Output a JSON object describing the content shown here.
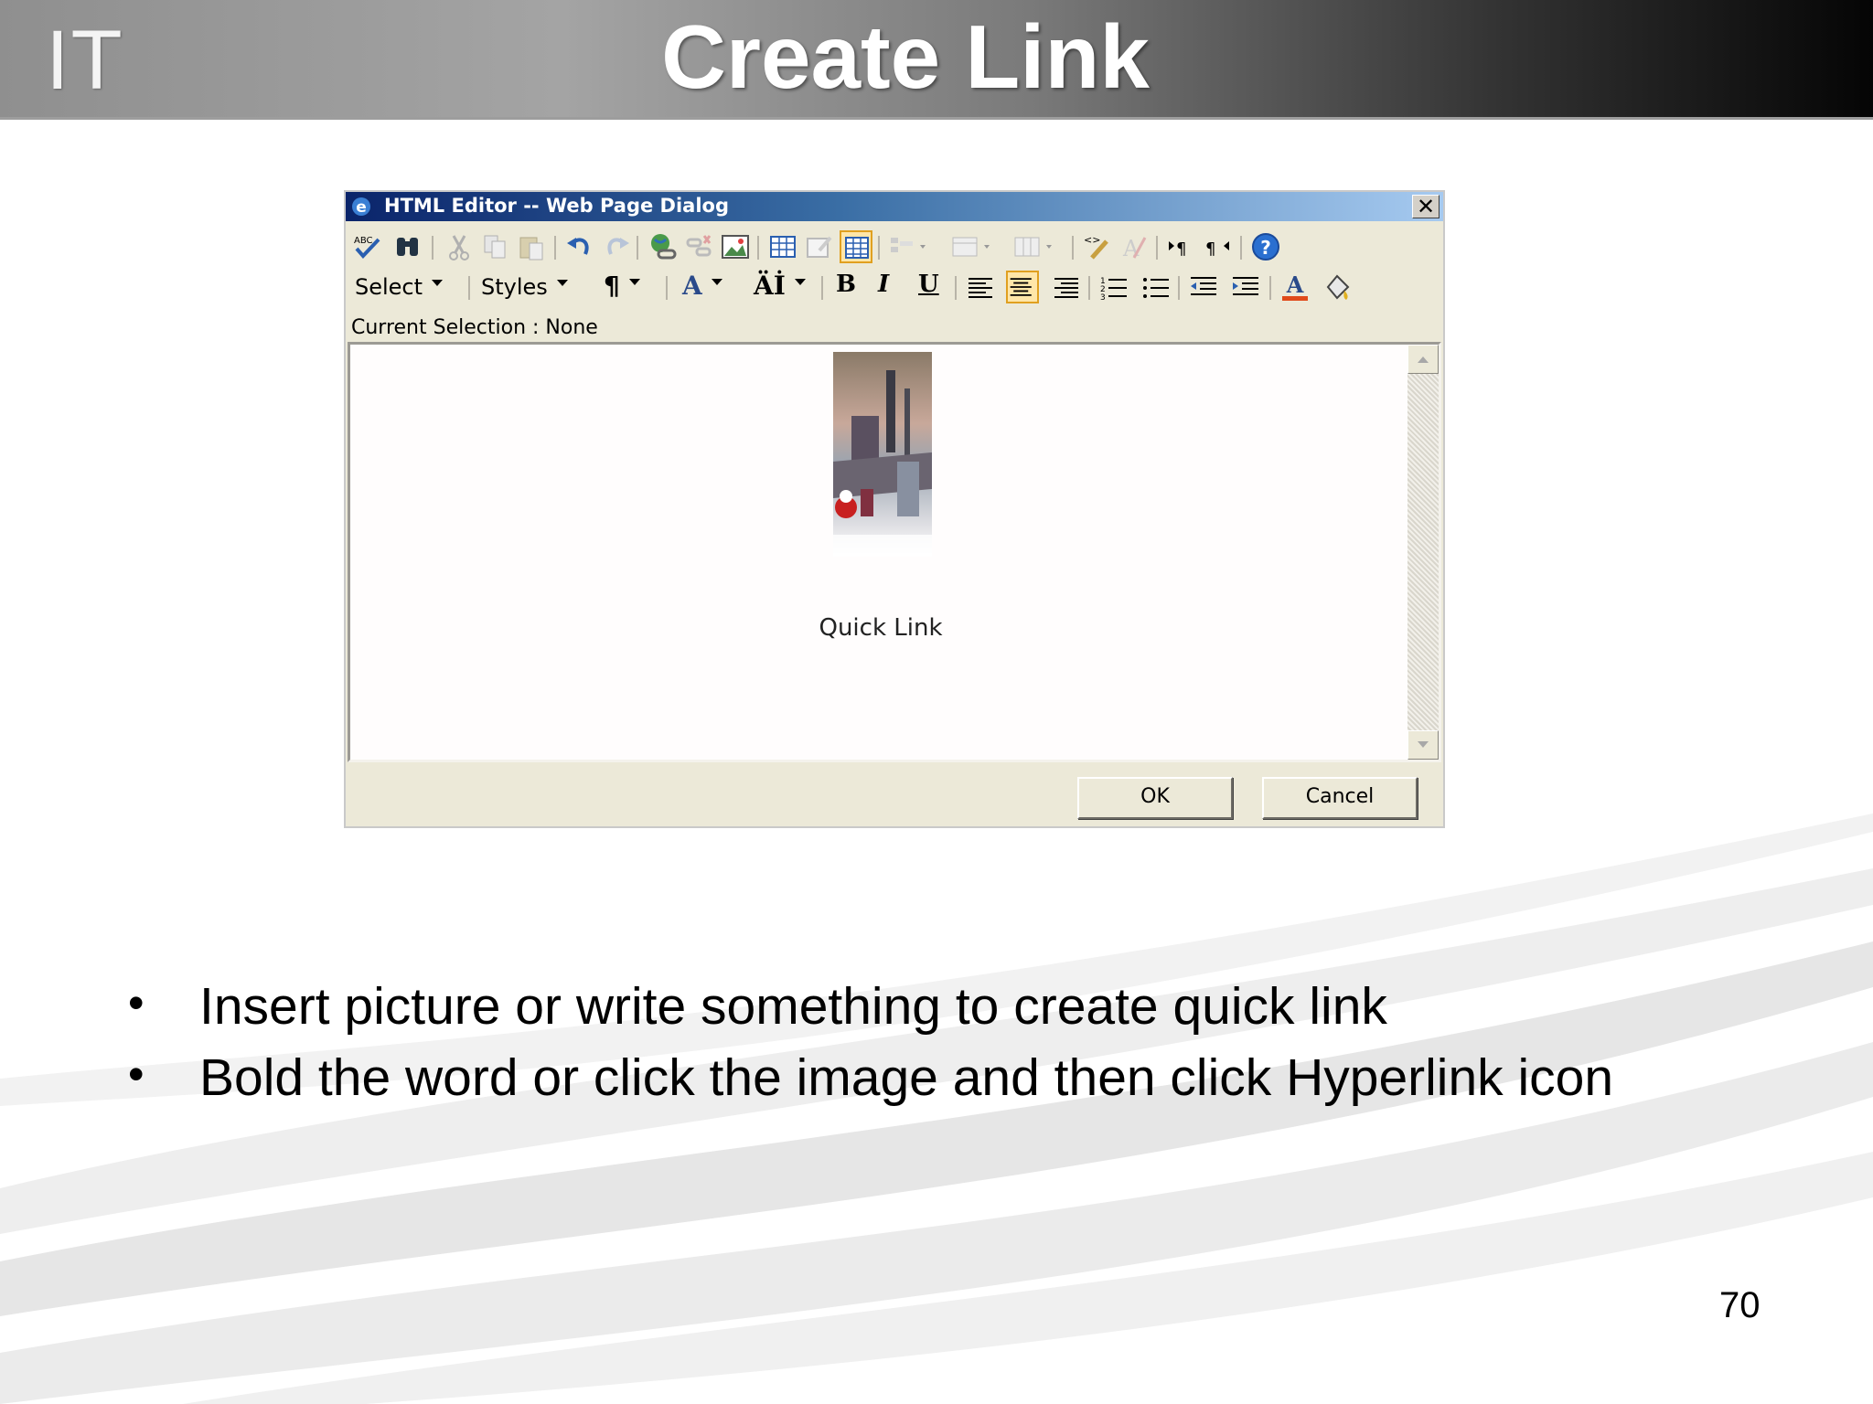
{
  "slide": {
    "logo": "IT",
    "title": "Create Link",
    "page_number": "70",
    "bullets": [
      "Insert picture or write something to create quick link",
      "Bold the word or click the image and then click Hyperlink icon"
    ]
  },
  "dialog": {
    "title": "HTML Editor -- Web Page Dialog",
    "close_label": "✕",
    "toolbar_row1_icons": [
      "spellcheck-icon",
      "find-icon",
      "cut-icon",
      "copy-icon",
      "paste-icon",
      "undo-icon",
      "redo-icon",
      "hyperlink-icon",
      "unlink-icon",
      "insert-image-icon",
      "insert-table-icon",
      "edit-table-icon",
      "table-gridlines-icon",
      "table-rows-icon",
      "table-cells-icon",
      "table-columns-icon",
      "edit-source-icon",
      "clean-format-icon",
      "ltr-icon",
      "rtl-icon",
      "help-icon"
    ],
    "toolbar_row2": {
      "select_label": "Select",
      "styles_label": "Styles",
      "paragraph_glyph": "¶",
      "font_glyph": "A",
      "font_size_glyph": "Äİ",
      "bold_glyph": "B",
      "italic_glyph": "I",
      "underline_glyph": "U"
    },
    "current_selection": "Current Selection : None",
    "editor_caption": "Quick Link",
    "ok_label": "OK",
    "cancel_label": "Cancel"
  },
  "colors": {
    "titlebar_start": "#0a246a",
    "titlebar_end": "#a6caf0",
    "dialog_bg": "#ece9d8",
    "active_button": "#ffe6a8"
  }
}
